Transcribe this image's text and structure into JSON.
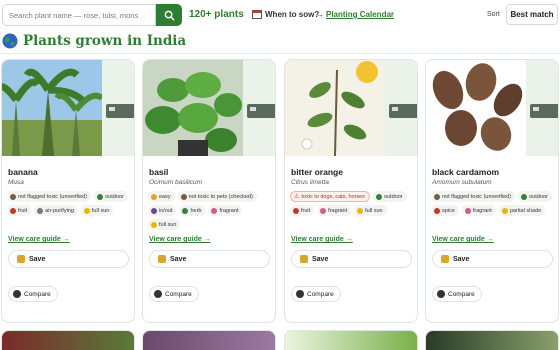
{
  "header": {
    "search_placeholder": "Search plant name — rose, tulsi, mons",
    "plant_count": "120+ plants",
    "when_label": "When to sow?",
    "arrow": "→",
    "calendar_link": "Planting Calendar",
    "sort_label": "Sort",
    "sort_value": "Best match"
  },
  "page_title": "Plants grown in India",
  "cards": [
    {
      "name": "banana",
      "latin": "Musa",
      "tags": [
        {
          "text": "not flagged toxic (unverified)",
          "color": "#7a5a3a"
        },
        {
          "text": "outdoor",
          "color": "#3a7d3a"
        },
        {
          "text": "fruit",
          "color": "#c0392b"
        },
        {
          "text": "air-purifying",
          "color": "#777777"
        },
        {
          "text": "full sun",
          "color": "#e6b800"
        }
      ],
      "care_link": "View care guide →",
      "save_label": "Save",
      "compare_label": "Compare"
    },
    {
      "name": "basil",
      "latin": "Ocimum basilicum",
      "tags": [
        {
          "text": "easy",
          "color": "#d8a62a"
        },
        {
          "text": "not toxic to pets (checked)",
          "color": "#7a5a3a"
        },
        {
          "text": "in/out",
          "color": "#6b4b8a"
        },
        {
          "text": "herb",
          "color": "#3a7d3a"
        },
        {
          "text": "fragrant",
          "color": "#d15b8a"
        },
        {
          "text": "full sun",
          "color": "#e6b800"
        }
      ],
      "care_link": "View care guide →",
      "save_label": "Save",
      "compare_label": "Compare"
    },
    {
      "name": "bitter orange",
      "latin": "Citrus limetta",
      "warning": "toxic to dogs, cats, horses",
      "tags": [
        {
          "text": "outdoor",
          "color": "#3a7d3a"
        },
        {
          "text": "fruit",
          "color": "#c0392b"
        },
        {
          "text": "fragrant",
          "color": "#d15b8a"
        },
        {
          "text": "full sun",
          "color": "#e6b800"
        }
      ],
      "care_link": "View care guide →",
      "save_label": "Save",
      "compare_label": "Compare"
    },
    {
      "name": "black cardamom",
      "latin": "Amomum subulatum",
      "tags": [
        {
          "text": "not flagged toxic (unverified)",
          "color": "#7a5a3a"
        },
        {
          "text": "outdoor",
          "color": "#3a7d3a"
        },
        {
          "text": "spice",
          "color": "#c0392b"
        },
        {
          "text": "fragrant",
          "color": "#d15b8a"
        },
        {
          "text": "partial shade",
          "color": "#e6b800"
        }
      ],
      "care_link": "View care guide →",
      "save_label": "Save",
      "compare_label": "Compare"
    }
  ],
  "colors": {
    "accent": "#2e7d32",
    "warning": "#a33333"
  }
}
